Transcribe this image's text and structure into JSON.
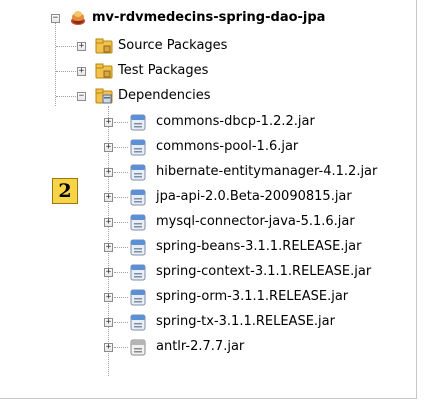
{
  "project": {
    "name": "mv-rdvmedecins-spring-dao-jpa",
    "expander_symbol": "−",
    "icon": "maven-project-icon"
  },
  "nodes": [
    {
      "label": "Source Packages",
      "expander_symbol": "+",
      "icon": "package-folder-icon"
    },
    {
      "label": "Test Packages",
      "expander_symbol": "+",
      "icon": "package-folder-icon"
    },
    {
      "label": "Dependencies",
      "expander_symbol": "−",
      "icon": "library-folder-icon"
    }
  ],
  "dependencies": [
    {
      "label": "commons-dbcp-1.2.2.jar",
      "icon": "jar-icon"
    },
    {
      "label": "commons-pool-1.6.jar",
      "icon": "jar-icon"
    },
    {
      "label": "hibernate-entitymanager-4.1.2.jar",
      "icon": "jar-icon"
    },
    {
      "label": "jpa-api-2.0.Beta-20090815.jar",
      "icon": "jar-icon"
    },
    {
      "label": "mysql-connector-java-5.1.6.jar",
      "icon": "jar-icon"
    },
    {
      "label": "spring-beans-3.1.1.RELEASE.jar",
      "icon": "jar-icon"
    },
    {
      "label": "spring-context-3.1.1.RELEASE.jar",
      "icon": "jar-icon"
    },
    {
      "label": "spring-orm-3.1.1.RELEASE.jar",
      "icon": "jar-icon"
    },
    {
      "label": "spring-tx-3.1.1.RELEASE.jar",
      "icon": "jar-icon"
    },
    {
      "label": "antlr-2.7.7.jar",
      "icon": "jar-gray-icon"
    }
  ],
  "dependency_expander_symbol": "+",
  "callout": {
    "label": "2"
  },
  "colors": {
    "callout_fill": "#f7d447",
    "jar_blue": "#5b8fd6",
    "folder_yellow": "#f2c14e"
  }
}
